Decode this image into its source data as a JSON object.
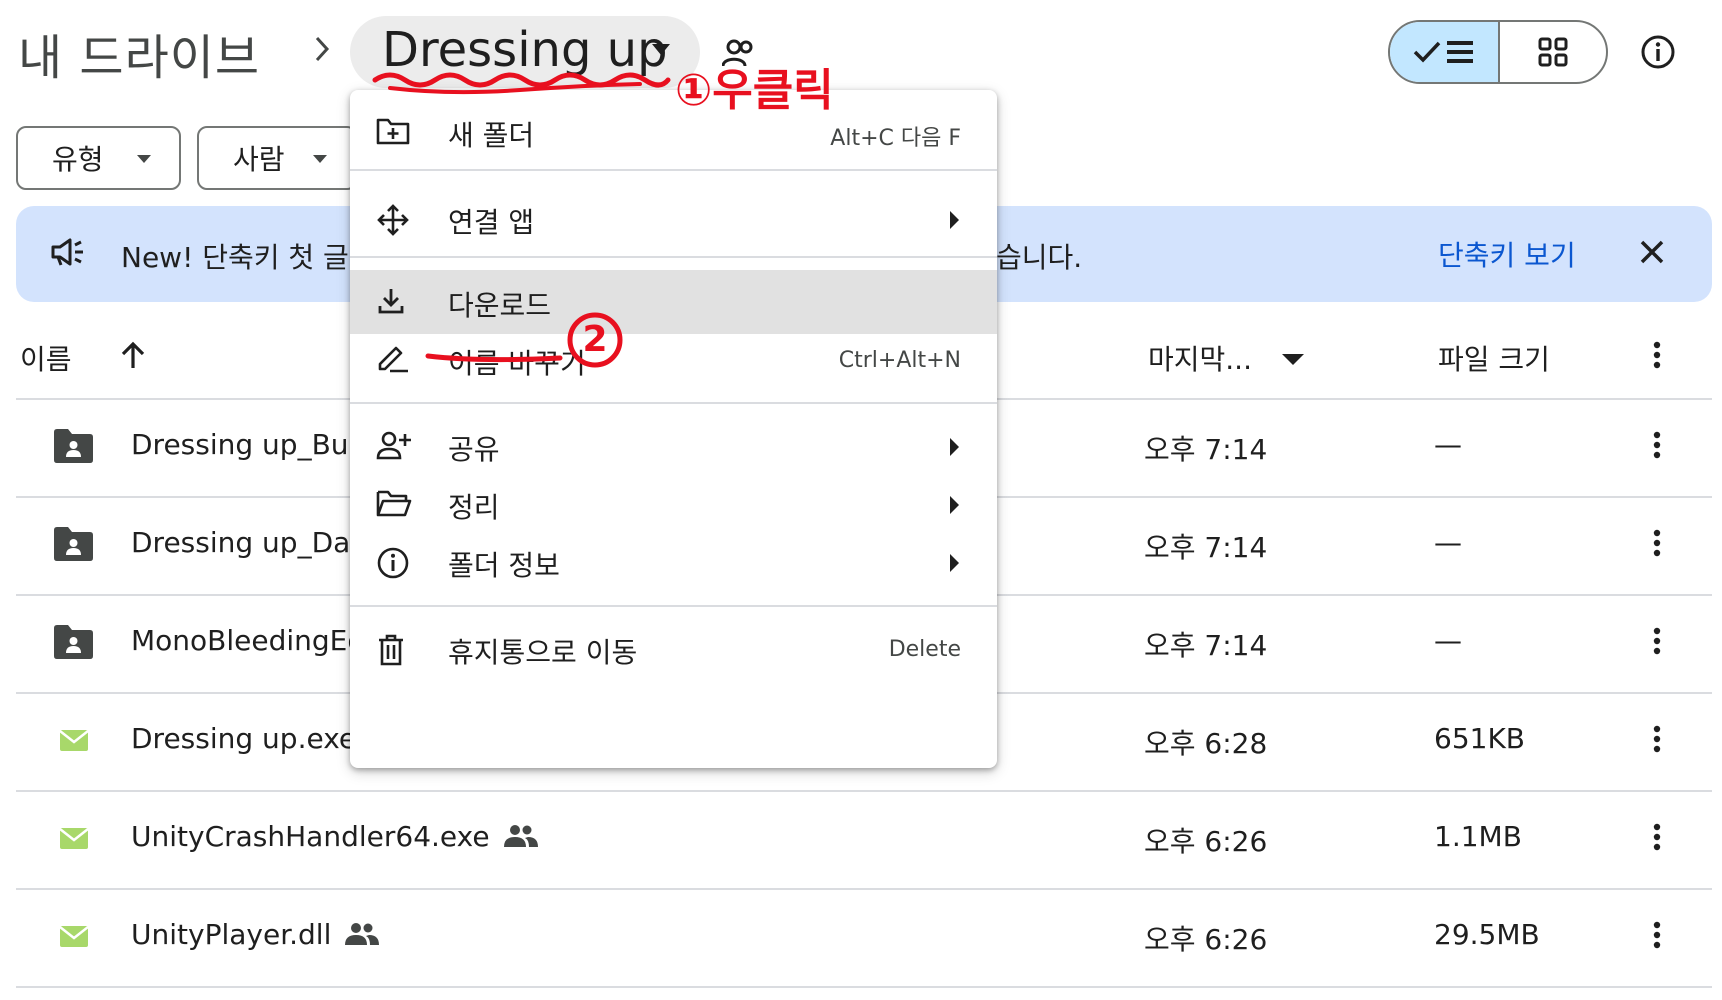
{
  "header": {
    "root": "내 드라이브",
    "separator": "›",
    "current_folder": "Dressing up"
  },
  "filters": [
    {
      "label": "유형"
    },
    {
      "label": "사람"
    }
  ],
  "banner": {
    "text_left": "New! 단축키 첫 글",
    "text_right": "습니다.",
    "link": "단축키 보기"
  },
  "columns": {
    "name": "이름",
    "modified": "마지막...",
    "size": "파일 크기"
  },
  "rows": [
    {
      "name": "Dressing up_Burs",
      "icon": "shared-folder-icon",
      "shared": false,
      "modified": "오후 7:14",
      "size": "—"
    },
    {
      "name": "Dressing up_Data",
      "icon": "shared-folder-icon",
      "shared": false,
      "modified": "오후 7:14",
      "size": "—"
    },
    {
      "name": "MonoBleedingEd",
      "icon": "shared-folder-icon",
      "shared": false,
      "modified": "오후 7:14",
      "size": "—"
    },
    {
      "name": "Dressing up.exe",
      "icon": "binary-file-icon",
      "shared": false,
      "modified": "오후 6:28",
      "size": "651KB"
    },
    {
      "name": "UnityCrashHandler64.exe",
      "icon": "binary-file-icon",
      "shared": true,
      "modified": "오후 6:26",
      "size": "1.1MB"
    },
    {
      "name": "UnityPlayer.dll",
      "icon": "binary-file-icon",
      "shared": true,
      "modified": "오후 6:26",
      "size": "29.5MB"
    }
  ],
  "context_menu": {
    "items": [
      {
        "label": "새 폴더",
        "shortcut": "Alt+C 다음 F",
        "icon": "new-folder-icon"
      },
      {
        "label": "연결 앱",
        "icon": "open-with-icon",
        "submenu": true
      },
      {
        "label": "다운로드",
        "icon": "download-icon",
        "highlighted": true
      },
      {
        "label": "이름 바꾸기",
        "shortcut": "Ctrl+Alt+N",
        "icon": "rename-icon"
      },
      {
        "label": "공유",
        "icon": "share-icon",
        "submenu": true
      },
      {
        "label": "정리",
        "icon": "organize-folder-icon",
        "submenu": true
      },
      {
        "label": "폴더 정보",
        "icon": "info-icon",
        "submenu": true
      },
      {
        "label": "휴지통으로 이동",
        "shortcut": "Delete",
        "icon": "trash-icon"
      }
    ]
  },
  "annotations": {
    "step1": "①우클릭",
    "step2": "②"
  },
  "colors": {
    "accent_blue": "#0b57d0",
    "banner_bg": "#d3e3fd",
    "selected_toggle": "#c2e7ff",
    "annotation_red": "#e8101f",
    "binary_icon_green": "#a8d86a"
  }
}
